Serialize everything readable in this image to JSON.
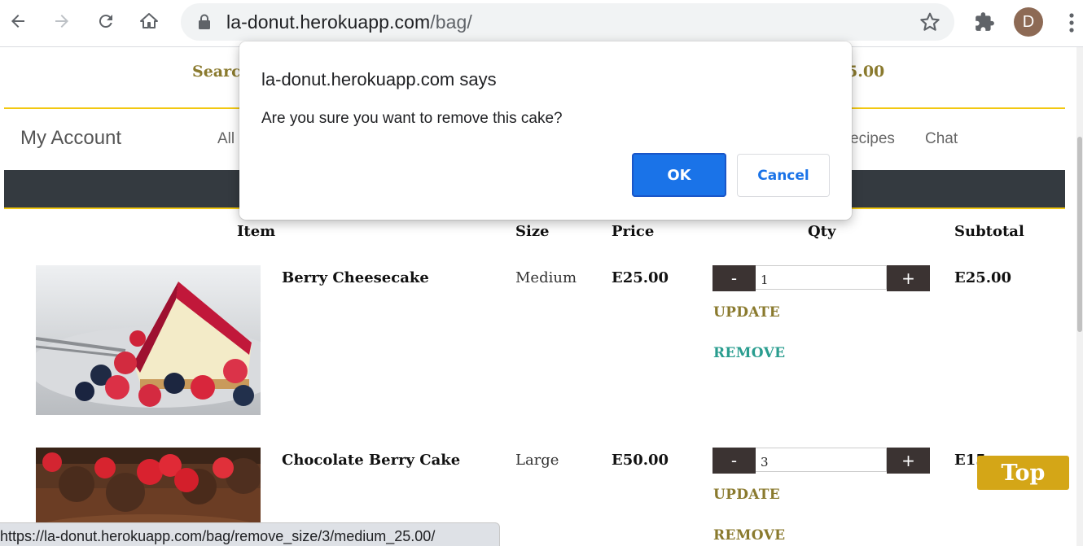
{
  "browser": {
    "url_host": "la-donut.herokuapp.com",
    "url_path": "/bag/",
    "profile_initial": "D"
  },
  "topbar": {
    "search_label": "Search",
    "bag_total_fragment": "5.00"
  },
  "nav": {
    "my_account": "My Account",
    "items": [
      "All",
      "ecipes",
      "Chat"
    ]
  },
  "table": {
    "headers": {
      "item": "Item",
      "size": "Size",
      "price": "Price",
      "qty": "Qty",
      "subtotal": "Subtotal"
    },
    "rows": [
      {
        "name": "Berry Cheesecake",
        "size": "Medium",
        "price": "E25.00",
        "qty": "1",
        "subtotal": "E25.00",
        "update": "UPDATE",
        "remove": "REMOVE"
      },
      {
        "name": "Chocolate Berry Cake",
        "size": "Large",
        "price": "E50.00",
        "qty": "3",
        "subtotal": "E15",
        "update": "UPDATE",
        "remove": "REMOVE"
      }
    ],
    "minus": "-",
    "plus": "+"
  },
  "top_button": "Top",
  "status_url": "https://la-donut.herokuapp.com/bag/remove_size/3/medium_25.00/",
  "dialog": {
    "title": "la-donut.herokuapp.com says",
    "message": "Are you sure you want to remove this cake?",
    "ok": "OK",
    "cancel": "Cancel"
  },
  "colors": {
    "accent_gold": "#8a7a2e",
    "yellow_line": "#f2c811",
    "remove_teal": "#2a9d8f",
    "dialog_blue": "#1a73e8",
    "dark_bar": "#343a40"
  }
}
